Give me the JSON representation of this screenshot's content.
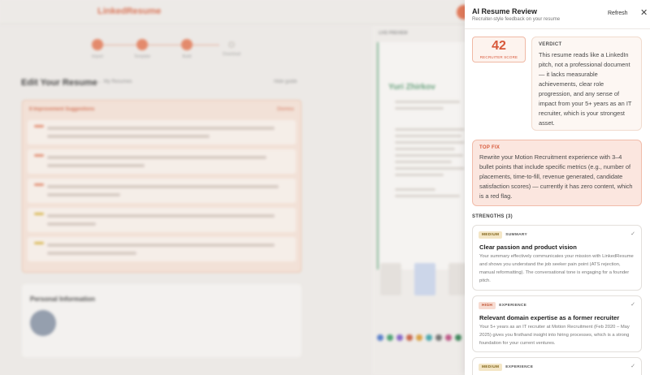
{
  "background": {
    "logo": "LinkedResume",
    "steps": [
      {
        "label": "Import"
      },
      {
        "label": "Template"
      },
      {
        "label": "Build"
      },
      {
        "label": "Download"
      }
    ],
    "page_title": "Edit Your Resume",
    "page_subtitle": "← My Resumes",
    "right_link": "Hide guide",
    "improvements_title": "8 Improvement Suggestions",
    "improvements_dismiss": "Dismiss",
    "personal_title": "Personal Information",
    "preview_label": "LIVE PREVIEW",
    "preview_name": "Yuri Zhirkov"
  },
  "panel": {
    "title": "AI Resume Review",
    "subtitle": "Recruiter-style feedback on your resume",
    "refresh_label": "Refresh",
    "close_icon": "✕",
    "score": {
      "value": "42",
      "label": "RECRUITER SCORE"
    },
    "verdict": {
      "label": "VERDICT",
      "text": "This resume reads like a LinkedIn pitch, not a professional document — it lacks measurable achievements, clear role progression, and any sense of impact from your 5+ years as an IT recruiter, which is your strongest asset."
    },
    "top_fix": {
      "label": "TOP FIX",
      "text": "Rewrite your Motion Recruitment experience with 3–4 bullet points that include specific metrics (e.g., number of placements, time-to-fill, revenue generated, candidate satisfaction scores) — currently it has zero content, which is a red flag."
    },
    "strengths_label": "STRENGTHS (3)",
    "strengths": [
      {
        "level": "MEDIUM",
        "category": "SUMMARY",
        "title": "Clear passion and product vision",
        "body": "Your summary effectively communicates your mission with LinkedResume and shows you understand the job seeker pain point (ATS rejection, manual reformatting). The conversational tone is engaging for a founder pitch."
      },
      {
        "level": "HIGH",
        "category": "EXPERIENCE",
        "title": "Relevant domain expertise as a former recruiter",
        "body": "Your 5+ years as an IT recruiter at Motion Recruitment (Feb 2020 – May 2025) gives you firsthand insight into hiring processes, which is a strong foundation for your current ventures."
      },
      {
        "level": "MEDIUM",
        "category": "EXPERIENCE",
        "title": "",
        "body": ""
      }
    ]
  }
}
